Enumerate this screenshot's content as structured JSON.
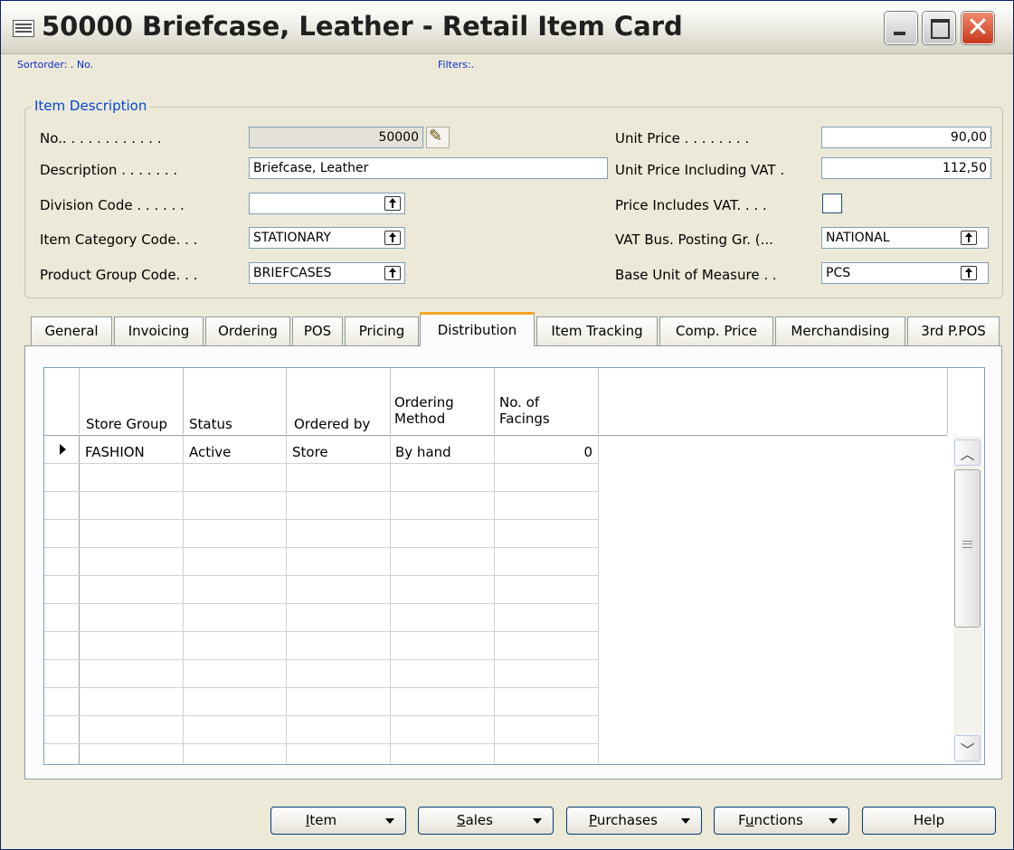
{
  "window": {
    "title": "50000 Briefcase, Leather - Retail Item Card",
    "controls": [
      "minimize",
      "maximize",
      "close"
    ]
  },
  "info": {
    "sortorder": "Sortorder: . No.",
    "filters": "Filters:."
  },
  "item_description": {
    "group_label": "Item Description",
    "left": [
      {
        "label": "No.. . . . . . . . . . . .",
        "value": "50000"
      },
      {
        "label": "Description . . . . . . .",
        "value": "Briefcase, Leather"
      },
      {
        "label": "Division Code . . . . . .",
        "value": ""
      },
      {
        "label": "Item Category Code. . .",
        "value": "STATIONARY"
      },
      {
        "label": "Product Group Code. . .",
        "value": "BRIEFCASES"
      }
    ],
    "right": [
      {
        "label": "Unit Price . . . . . . . .",
        "value": "90,00"
      },
      {
        "label": "Unit Price Including VAT .",
        "value": "112,50"
      },
      {
        "label": "Price Includes VAT. . . .",
        "checked": false
      },
      {
        "label": "VAT Bus. Posting Gr. (...",
        "value": "NATIONAL"
      },
      {
        "label": "Base Unit of Measure . .",
        "value": "PCS"
      }
    ]
  },
  "tabs": [
    {
      "label": "General"
    },
    {
      "label": "Invoicing"
    },
    {
      "label": "Ordering"
    },
    {
      "label": "POS"
    },
    {
      "label": "Pricing"
    },
    {
      "label": "Distribution",
      "active": true
    },
    {
      "label": "Item Tracking"
    },
    {
      "label": "Comp. Price"
    },
    {
      "label": "Merchandising"
    },
    {
      "label": "3rd P.POS"
    }
  ],
  "grid": {
    "headers": [
      {
        "line1": "",
        "line2": "Store Group"
      },
      {
        "line1": "",
        "line2": "Status"
      },
      {
        "line1": "",
        "line2": "Ordered by"
      },
      {
        "line1": "Ordering",
        "line2": "Method"
      },
      {
        "line1": "No. of",
        "line2": "Facings"
      }
    ],
    "rows": [
      {
        "store_group": "FASHION",
        "status": "Active",
        "ordered_by": "Store",
        "ordering_method": "By hand",
        "facings": "0"
      }
    ]
  },
  "buttons": {
    "item": {
      "u": "I",
      "rest": "tem"
    },
    "sales": {
      "u": "S",
      "rest": "ales"
    },
    "purchases": {
      "u": "P",
      "rest": "urchases"
    },
    "functions": {
      "pre": "F",
      "u": "u",
      "rest": "nctions"
    },
    "help": "Help"
  },
  "icons": {
    "window": "form-icon",
    "edit": "pencil-icon",
    "lookup": "lookup-arrow-icon"
  }
}
